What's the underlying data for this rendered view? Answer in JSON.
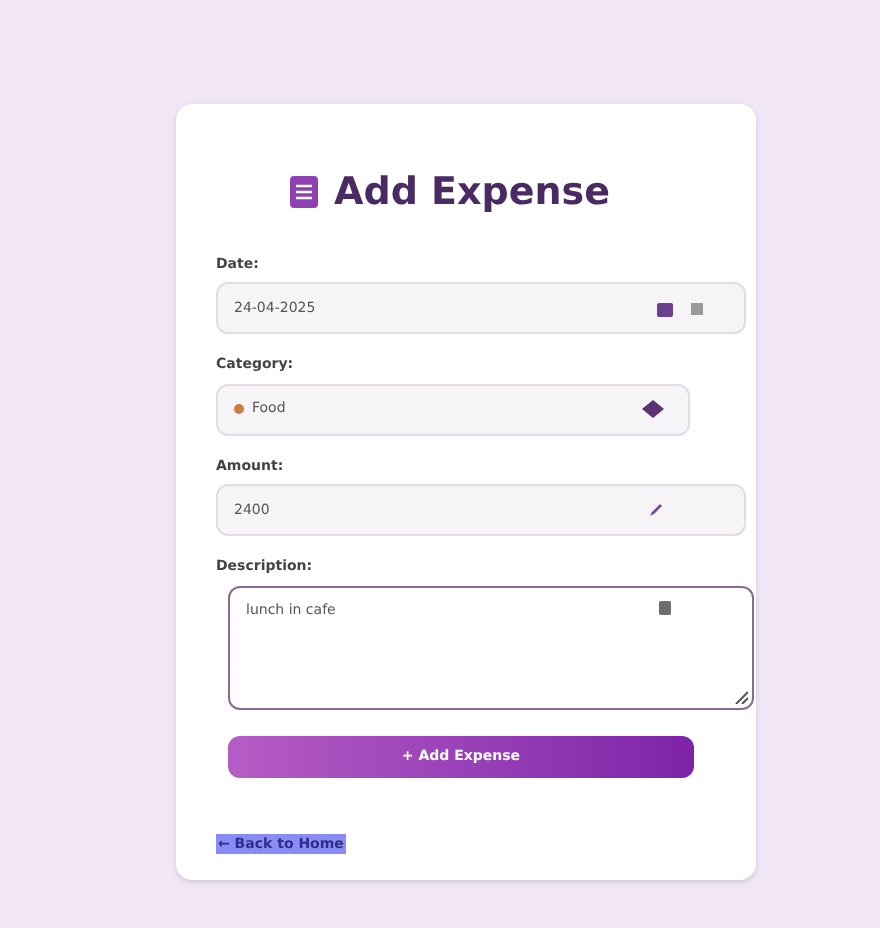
{
  "title": "Add Expense",
  "fields": [
    {
      "kind": "date",
      "label": "Date:",
      "value": "24-04-2025"
    },
    {
      "kind": "select",
      "label": "Category:",
      "value": "Food"
    },
    {
      "kind": "number",
      "label": "Amount:",
      "value": "2400"
    },
    {
      "kind": "textarea",
      "label": "Description:",
      "value": "lunch in cafe"
    }
  ],
  "submit": "+ Add Expense",
  "back_link": "← Back to Home"
}
